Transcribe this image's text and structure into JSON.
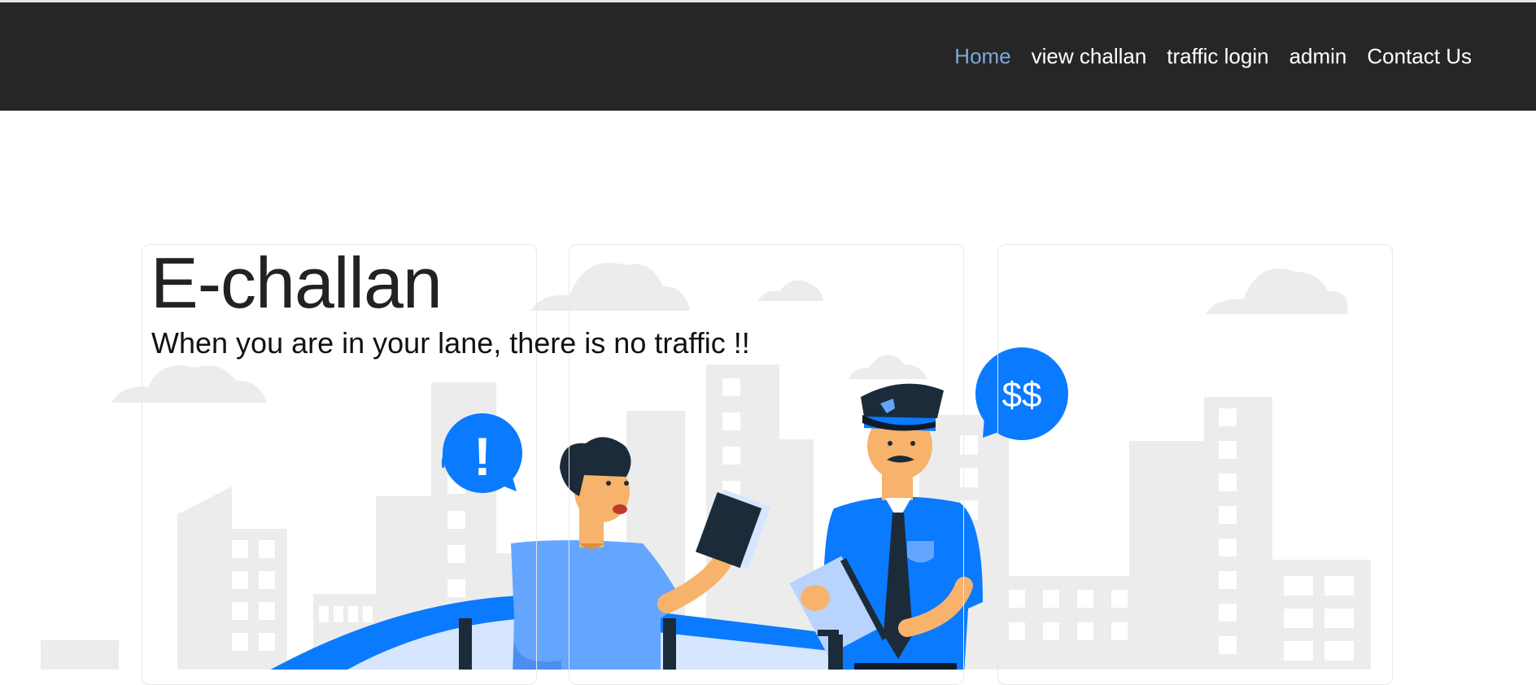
{
  "nav": {
    "items": [
      {
        "label": "Home",
        "active": true
      },
      {
        "label": "view challan",
        "active": false
      },
      {
        "label": "traffic login",
        "active": false
      },
      {
        "label": "admin",
        "active": false
      },
      {
        "label": "Contact Us",
        "active": false
      }
    ]
  },
  "hero": {
    "title": "E-challan",
    "subtitle": "When you are in your lane, there is no traffic !!"
  },
  "illustration": {
    "alert_symbol": "!",
    "money_symbol": "$$"
  },
  "colors": {
    "navbar_bg": "#262626",
    "nav_active": "#7fa8d9",
    "accent_blue": "#0a7aff",
    "light_blue": "#64a5ff"
  }
}
